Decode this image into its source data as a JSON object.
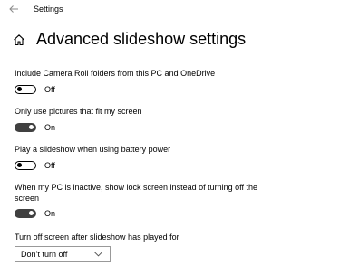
{
  "window": {
    "title": "Settings"
  },
  "page": {
    "title": "Advanced slideshow settings"
  },
  "settings": [
    {
      "label": "Include Camera Roll folders from this PC and OneDrive",
      "state": "Off",
      "on": false
    },
    {
      "label": "Only use pictures that fit my screen",
      "state": "On",
      "on": true
    },
    {
      "label": "Play a slideshow when using battery power",
      "state": "Off",
      "on": false
    },
    {
      "label": "When my PC is inactive, show lock screen instead of turning off the screen",
      "state": "On",
      "on": true
    }
  ],
  "screen_off": {
    "label": "Turn off screen after slideshow has played for",
    "selected": "Don’t turn off"
  },
  "icons": {
    "back": "back-arrow-icon",
    "home": "home-icon",
    "dropdown": "chevron-down-icon"
  },
  "colors": {
    "toggle_on": "#404040",
    "toggle_off_border": "#000000",
    "dropdown_border": "#999999"
  }
}
